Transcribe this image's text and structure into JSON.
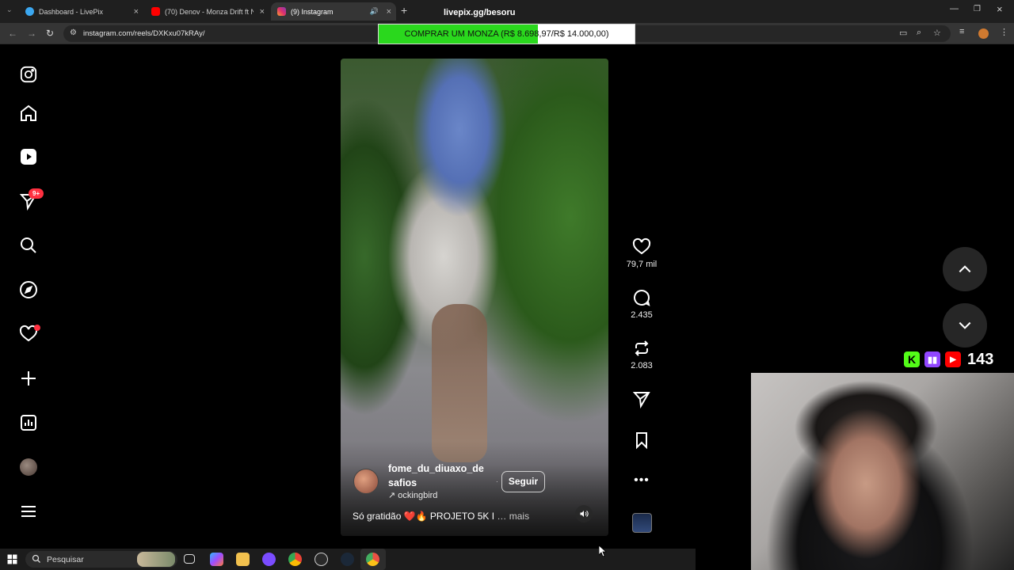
{
  "browser": {
    "tabs": [
      {
        "title": "Dashboard - LivePix",
        "color": "#3ba7f0"
      },
      {
        "title": "(70) Denov - Monza Drift ft NA",
        "color": "#ff0000"
      },
      {
        "title": "(9) Instagram",
        "color": "#e1306c"
      }
    ],
    "url": "instagram.com/reels/DXKxu07kRAy/"
  },
  "stream_overlay": {
    "title": "livepix.gg/besoru",
    "donation_goal": {
      "text": "COMPRAR UM MONZA (R$ 8.698,97/R$ 14.000,00)",
      "progress": 0.621
    },
    "viewer_count": "143"
  },
  "instagram": {
    "sidebar": {
      "messages_badge": "9+",
      "icons": [
        "instagram-logo-icon",
        "home-icon",
        "reels-icon",
        "messages-icon",
        "search-icon",
        "explore-icon",
        "notifications-icon",
        "create-icon",
        "dashboard-icon",
        "profile-avatar",
        "menu-icon"
      ]
    },
    "reel": {
      "author": "fome_du_diuaxo_desafios",
      "author_line1": "fome_du_diuaxo_de",
      "author_line2": "safios",
      "audio": "↗ ockingbird",
      "follow_label": "Seguir",
      "caption": "Só gratidão ❤️🔥 PROJETO 5K I",
      "caption_more": "… mais"
    },
    "actions": {
      "likes": "79,7 mil",
      "comments": "2.435",
      "reposts": "2.083"
    }
  },
  "taskbar": {
    "search_label": "Pesquisar"
  }
}
